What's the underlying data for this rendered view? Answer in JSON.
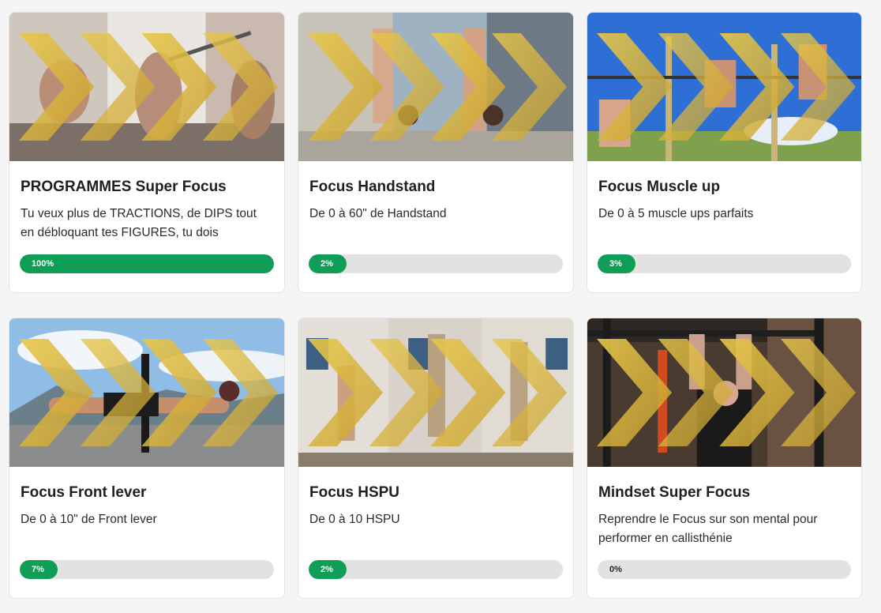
{
  "cards": [
    {
      "title": "PROGRAMMES Super Focus",
      "description": "Tu veux plus de TRACTIONS, de DIPS tout en débloquant tes FIGURES, tu dois devenir…",
      "progress": 100,
      "progress_label": "100%",
      "scene": "workout-collage"
    },
    {
      "title": "Focus Handstand",
      "description": "De 0 à 60\" de Handstand",
      "progress": 2,
      "progress_label": "2%",
      "scene": "handstand-street"
    },
    {
      "title": "Focus Muscle up",
      "description": "De 0 à 5 muscle ups parfaits",
      "progress": 3,
      "progress_label": "3%",
      "scene": "muscle-up-bars"
    },
    {
      "title": "Focus Front lever",
      "description": "De 0 à 10\" de Front lever",
      "progress": 7,
      "progress_label": "7%",
      "scene": "front-lever-lake"
    },
    {
      "title": "Focus HSPU",
      "description": "De 0 à 10 HSPU",
      "progress": 2,
      "progress_label": "2%",
      "scene": "hspu-wall"
    },
    {
      "title": "Mindset Super Focus",
      "description": "Reprendre le Focus sur son mental pour performer en callisthénie",
      "progress": 0,
      "progress_label": "0%",
      "scene": "gym-hang"
    }
  ],
  "colors": {
    "progress_fill": "#0f9d58",
    "progress_track": "#e2e2e2",
    "chevron_gold": "#e8c84a"
  }
}
